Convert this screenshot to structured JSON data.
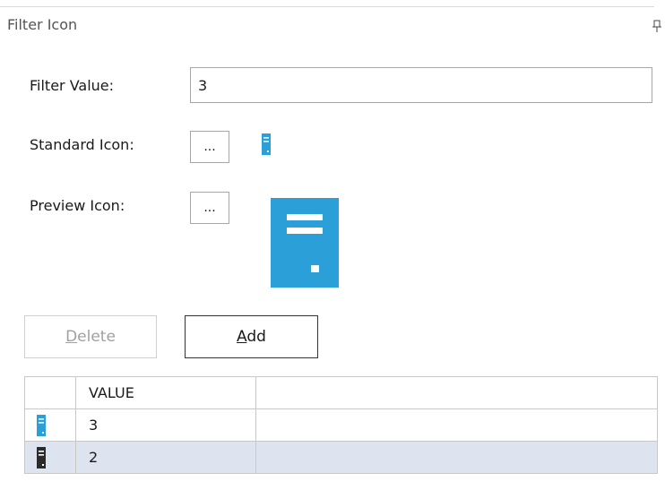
{
  "panel": {
    "title": "Filter Icon"
  },
  "form": {
    "filter_value_label": "Filter Value:",
    "filter_value": "3",
    "standard_icon_label": "Standard Icon:",
    "standard_icon_button": "...",
    "preview_icon_label": "Preview Icon:",
    "preview_icon_button": "..."
  },
  "icons": {
    "standard": "blue-document-icon",
    "preview": "blue-document-icon",
    "pin": "pin-icon"
  },
  "buttons": {
    "delete_access_key": "D",
    "delete_rest": "elete",
    "add_access_key": "A",
    "add_rest": "dd"
  },
  "grid": {
    "columns": [
      "",
      "VALUE",
      ""
    ],
    "rows": [
      {
        "icon": "blue-document-icon",
        "value": "3"
      },
      {
        "icon": "dark-document-icon",
        "value": "2"
      }
    ]
  },
  "colors": {
    "icon_blue": "#2a9fd8",
    "icon_dark": "#2b2b2b",
    "selected_row": "#dde4ef"
  }
}
